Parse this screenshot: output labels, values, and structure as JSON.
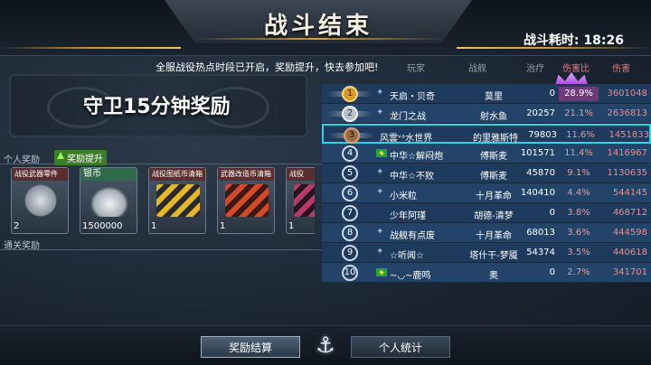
{
  "header": {
    "title": "战斗结束",
    "elapsed_label": "战斗耗时:",
    "elapsed_time": "18:26"
  },
  "notice": "全服战役热点时段已开启，奖励提升，快去参加吧!",
  "guard_reward_title": "守卫15分钟奖励",
  "personal_section": {
    "label": "个人奖励",
    "boost_label": "奖励提升"
  },
  "clear_section": {
    "label": "通关奖励"
  },
  "rewards": [
    {
      "name": "战役武器零件",
      "count": "2",
      "icon": "weapon-part-icon"
    },
    {
      "name": "银币",
      "count": "1500000",
      "icon": "silver-coin-icon"
    },
    {
      "name": "战役图纸币清箱",
      "count": "1",
      "icon": "crate-icon"
    },
    {
      "name": "武器改造币清箱",
      "count": "1",
      "icon": "crate-icon"
    },
    {
      "name": "战役",
      "count": "1",
      "icon": "crate-icon"
    }
  ],
  "rank_headers": {
    "player": "玩家",
    "ship": "战舰",
    "heal": "治疗",
    "damage_ratio": "伤害比",
    "damage": "伤害"
  },
  "ranks": [
    {
      "rank": "1",
      "name": "天启・贝奇",
      "ship": "莫里",
      "heal": "0",
      "ratio": "28.9%",
      "damage": "3601048"
    },
    {
      "rank": "2",
      "name": "龙门之战",
      "ship": "射水鱼",
      "heal": "20257",
      "ratio": "21.1%",
      "damage": "2636813"
    },
    {
      "rank": "3",
      "name": "风雲ᵛᵃ水世界",
      "ship": "的里雅斯特",
      "heal": "79803",
      "ratio": "11.6%",
      "damage": "1451833"
    },
    {
      "rank": "4",
      "name": "中华☆解闷炮",
      "ship": "傅斯麦",
      "heal": "101571",
      "ratio": "11.4%",
      "damage": "1416967"
    },
    {
      "rank": "5",
      "name": "中华☆不败",
      "ship": "傅斯麦",
      "heal": "45870",
      "ratio": "9.1%",
      "damage": "1130635"
    },
    {
      "rank": "6",
      "name": "小米粒",
      "ship": "十月革命",
      "heal": "140410",
      "ratio": "4.4%",
      "damage": "544145"
    },
    {
      "rank": "7",
      "name": "少年阿瑾",
      "ship": "胡德-清梦",
      "heal": "0",
      "ratio": "3.8%",
      "damage": "468712"
    },
    {
      "rank": "8",
      "name": "战舰有点废",
      "ship": "十月革命",
      "heal": "68013",
      "ratio": "3.6%",
      "damage": "444598"
    },
    {
      "rank": "9",
      "name": "☆听闻☆",
      "ship": "塔什干-梦魇",
      "heal": "54374",
      "ratio": "3.5%",
      "damage": "440618"
    },
    {
      "rank": "10",
      "name": "~◡~鹿鸣",
      "ship": "奥",
      "heal": "0",
      "ratio": "2.7%",
      "damage": "341701"
    }
  ],
  "bottom_tabs": {
    "reward_settlement": "奖励结算",
    "personal_stats": "个人统计"
  },
  "colors": {
    "accent_gold": "#d9a441",
    "row_blue": "#1e3a5c",
    "self_highlight": "#2fd3e4",
    "damage_red": "#f18a8a"
  }
}
